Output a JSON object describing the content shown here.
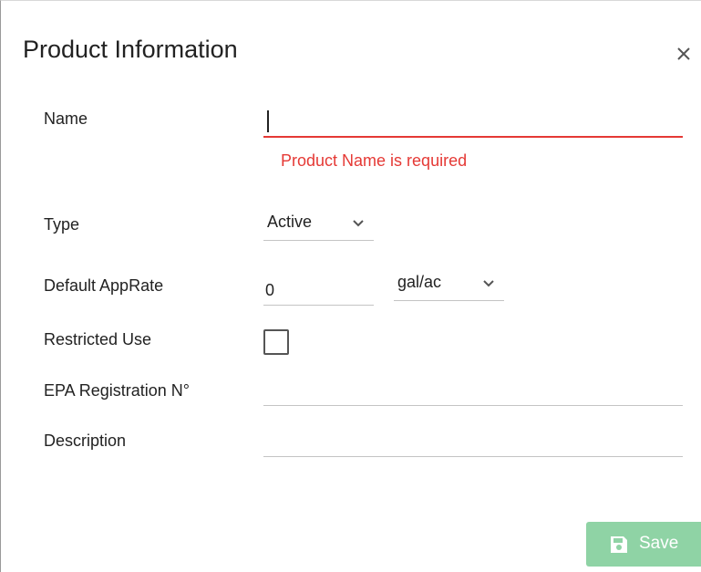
{
  "dialog": {
    "title": "Product Information",
    "close_icon": "close-icon"
  },
  "form": {
    "name": {
      "label": "Name",
      "value": "",
      "error": "Product Name is required"
    },
    "type": {
      "label": "Type",
      "selected": "Active"
    },
    "default_apprate": {
      "label": "Default AppRate",
      "value": "0",
      "unit_selected": "gal/ac"
    },
    "restricted_use": {
      "label": "Restricted Use",
      "checked": false
    },
    "epa_registration": {
      "label": "EPA Registration N°",
      "value": ""
    },
    "description": {
      "label": "Description",
      "value": ""
    }
  },
  "actions": {
    "save_label": "Save",
    "save_icon": "floppy-disk-icon"
  },
  "colors": {
    "error": "#e53935",
    "save_button": "#8fd3a5",
    "underline": "#c4c4c4"
  }
}
